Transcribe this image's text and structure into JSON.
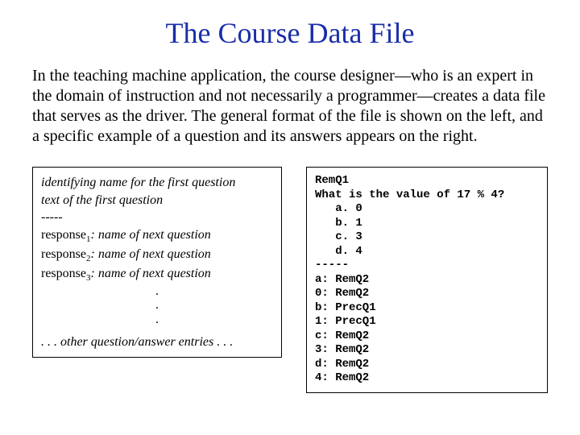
{
  "title": "The Course Data File",
  "paragraph": "In the teaching machine application, the course designer—who is an expert in the domain of instruction and not necessarily a programmer—creates a data file that serves as the driver.  The general format of the file is shown on the left, and a specific example of a question and its answers appears on the right.",
  "left": {
    "line1": "identifying name for the first question",
    "line2": "text of the first question",
    "dashes": "-----",
    "resp_prefix": "response",
    "resp_suffix": ": name of next question",
    "sub1": "1",
    "sub2": "2",
    "sub3": "3",
    "dot": ".",
    "other": ". . . other question/answer entries . . ."
  },
  "right": {
    "l1": "RemQ1",
    "l2": "What is the value of 17 % 4?",
    "l3": "   a. 0",
    "l4": "   b. 1",
    "l5": "   c. 3",
    "l6": "   d. 4",
    "l7": "-----",
    "l8": "a: RemQ2",
    "l9": "0: RemQ2",
    "l10": "b: PrecQ1",
    "l11": "1: PrecQ1",
    "l12": "c: RemQ2",
    "l13": "3: RemQ2",
    "l14": "d: RemQ2",
    "l15": "4: RemQ2"
  }
}
